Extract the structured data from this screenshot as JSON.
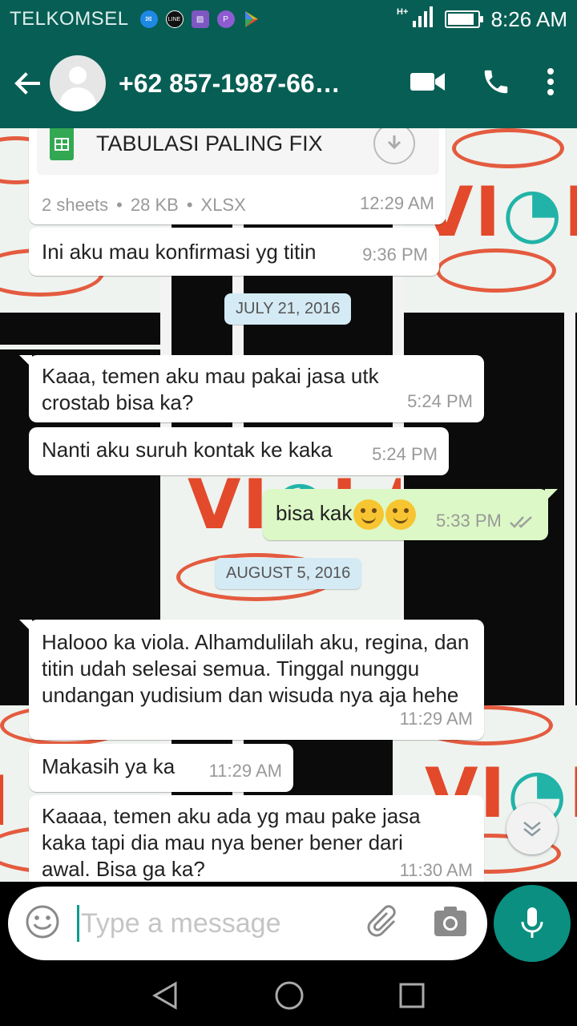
{
  "status_bar": {
    "carrier": "TELKOMSEL",
    "network_type": "H+",
    "time": "8:26 AM",
    "battery_level": 0.9,
    "notification_icons": [
      "bbm-icon",
      "line-today-icon",
      "gallery-icon",
      "purple-p-icon",
      "play-store-icon"
    ]
  },
  "header": {
    "contact_name": "+62 857-1987-66…"
  },
  "messages": [
    {
      "type": "file",
      "direction": "in",
      "file_name": "TABULASI PALING FIX",
      "file_sheets": "2 sheets",
      "file_size": "28 KB",
      "file_ext": "XLSX",
      "time": "12:29 AM"
    },
    {
      "type": "text",
      "direction": "in",
      "text": "Ini aku mau konfirmasi yg titin",
      "time": "9:36 PM"
    },
    {
      "type": "date",
      "text": "JULY 21, 2016"
    },
    {
      "type": "text",
      "direction": "in",
      "text": "Kaaa, temen aku mau pakai jasa utk crostab bisa ka?",
      "time": "5:24 PM"
    },
    {
      "type": "text",
      "direction": "in",
      "text": "Nanti aku suruh kontak ke kaka",
      "time": "5:24 PM"
    },
    {
      "type": "text",
      "direction": "out",
      "text": "bisa kak",
      "emoji": "smiling-face-emoji",
      "time": "5:33 PM",
      "status": "read"
    },
    {
      "type": "date",
      "text": "AUGUST 5, 2016"
    },
    {
      "type": "text",
      "direction": "in",
      "text": "Halooo ka viola. Alhamdulilah aku, regina, dan titin udah selesai semua. Tinggal nunggu undangan yudisium dan wisuda nya aja hehe",
      "time": "11:29 AM"
    },
    {
      "type": "text",
      "direction": "in",
      "text": "Makasih ya ka",
      "time": "11:29 AM"
    },
    {
      "type": "text",
      "direction": "in",
      "text": "Kaaaa, temen aku ada yg mau pake jasa kaka tapi dia mau nya bener bener dari awal. Bisa ga ka?",
      "time": "11:30 AM"
    }
  ],
  "input": {
    "placeholder": "Type a message"
  },
  "colors": {
    "header": "#075e54",
    "outgoing_bubble": "#dcf8c6",
    "incoming_bubble": "#ffffff",
    "date_chip": "#d4eaf4",
    "mic_button": "#0a8f80",
    "read_ticks": "#9e9e9e"
  }
}
